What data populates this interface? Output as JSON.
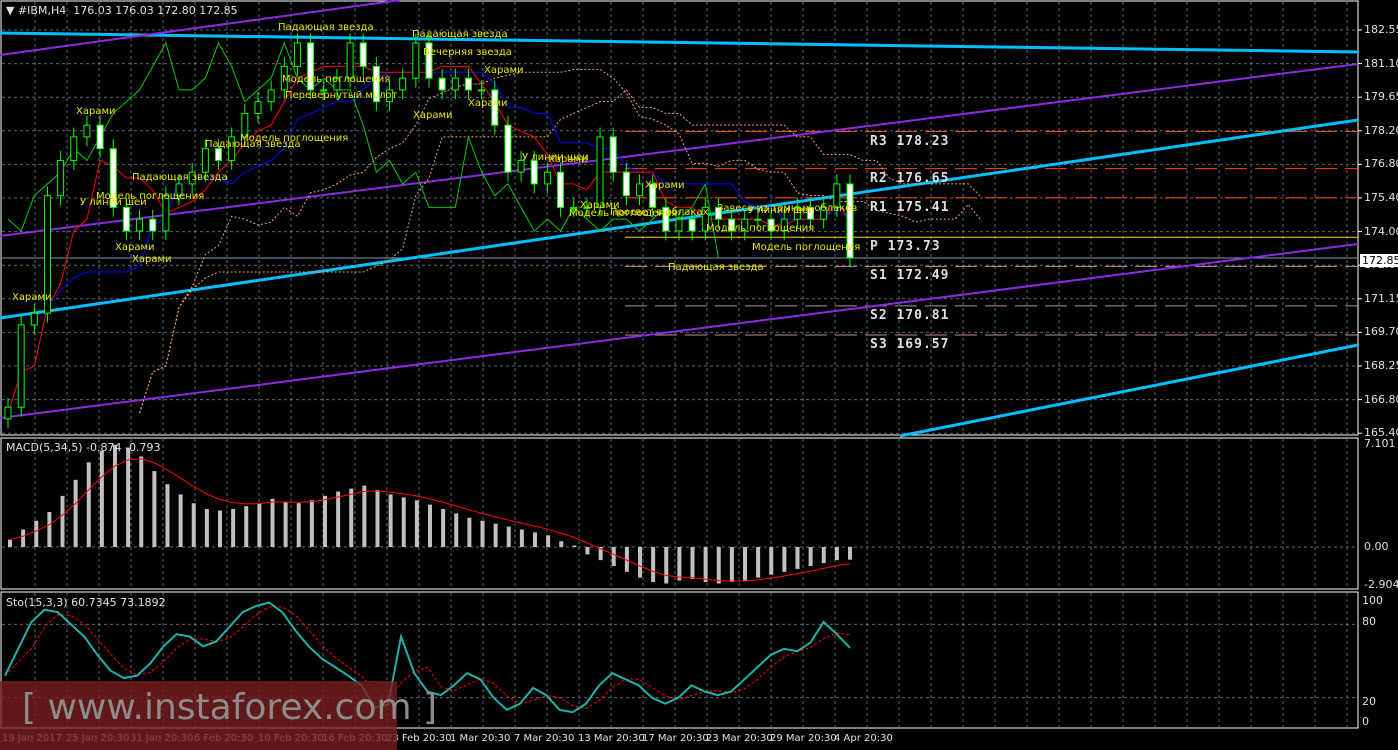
{
  "header": {
    "symbol": "#IBM,H4",
    "ohlc": "176.03 176.03 172.80 172.85"
  },
  "current_price": "172.85",
  "price_axis": [
    "182.55",
    "181.10",
    "179.65",
    "178.20",
    "176.80",
    "175.40",
    "174.00",
    "172.60",
    "171.15",
    "169.70",
    "168.25",
    "166.80",
    "165.40"
  ],
  "pivots": [
    {
      "name": "R3",
      "value": "178.23",
      "label": "R3  178.23"
    },
    {
      "name": "R2",
      "value": "176.65",
      "label": "R2  176.65"
    },
    {
      "name": "R1",
      "value": "175.41",
      "label": "R1  175.41"
    },
    {
      "name": "P",
      "value": "173.73",
      "label": " P  173.73"
    },
    {
      "name": "S1",
      "value": "172.49",
      "label": "S1  172.49"
    },
    {
      "name": "S2",
      "value": "170.81",
      "label": "S2  170.81"
    },
    {
      "name": "S3",
      "value": "169.57",
      "label": "S3  169.57"
    }
  ],
  "patterns": [
    "Падающая звезда",
    "Падающая звезда",
    "Вечерняя звезда",
    "Модель поглощения",
    "Перевернутый молот",
    "Харами",
    "Харами",
    "Харами",
    "Харами",
    "Модель поглощения",
    "Падающая звезда",
    "Падающая звезда",
    "Модель поглощения",
    "У линии шеи",
    "Харами",
    "Харами",
    "Харами",
    "У линии шеи",
    "Харами",
    "Модель поглощения",
    "Просвет в облаках",
    "Харами",
    "Харами",
    "Падающая звезда",
    "Завеса из темных облаков",
    "У линии шеи",
    "Модель поглощения",
    "Модель поглощения"
  ],
  "macd": {
    "legend": "MACD(5,34,5) -0.874 -0.793",
    "axis": [
      "7.101",
      "0.00",
      "-2.904"
    ]
  },
  "stoch": {
    "legend": "Sto(15,3,3) 60.7345 73.1892",
    "axis": [
      "100",
      "80",
      "20",
      "0"
    ]
  },
  "dates": [
    "19 Jan 2017",
    "25 Jan 20:30",
    "31 Jan 20:30",
    "6 Feb 20:30",
    "10 Feb 20:30",
    "16 Feb 20:30",
    "23 Feb 20:30",
    "1 Mar 20:30",
    "7 Mar 20:30",
    "13 Mar 20:30",
    "17 Mar 20:30",
    "23 Mar 20:30",
    "29 Mar 20:30",
    "4 Apr 20:30"
  ],
  "watermark": "[  www.instaforex.com ]",
  "colors": {
    "candle": "#00ff00",
    "tenkan": "#ff0000",
    "kijun": "#0000ff",
    "cloud": "#f4a460",
    "trend_cyan": "#00bfff",
    "trend_purple": "#8a2be2",
    "pivot_r": "#ff4500",
    "pivot_p": "#ffd700",
    "pivot_s": "#c09090",
    "macd_hist": "#c0c0c0",
    "macd_signal": "#ff0000",
    "stoch_main": "#20b2aa",
    "stoch_signal": "#ff0000"
  },
  "chart_data": {
    "type": "candlestick",
    "title": "#IBM,H4",
    "ylim": [
      165.4,
      182.55
    ],
    "closes": [
      166.5,
      170,
      170.5,
      175.5,
      177,
      178,
      178.5,
      177.5,
      175,
      174,
      174.5,
      174,
      175.5,
      176,
      176.5,
      177.5,
      177,
      178,
      179,
      179.5,
      180,
      181,
      182,
      180,
      180,
      180.5,
      182,
      181,
      179.5,
      180,
      180.5,
      182,
      180.5,
      180,
      180.5,
      180,
      180,
      178.5,
      176.5,
      177,
      176,
      176.5,
      175,
      175,
      175,
      178,
      176.5,
      175.5,
      176,
      175,
      174,
      174.5,
      174,
      175,
      174.5,
      174,
      174.5,
      174.5,
      174,
      174.5,
      175,
      174.5,
      175,
      176,
      172.85
    ],
    "macd_hist": [
      0.5,
      1.2,
      1.8,
      2.4,
      3.5,
      4.6,
      5.8,
      6.6,
      7.0,
      6.8,
      6.2,
      5.2,
      4.3,
      3.6,
      3.0,
      2.6,
      2.5,
      2.6,
      2.8,
      3.0,
      3.3,
      3.1,
      3.0,
      3.2,
      3.5,
      3.8,
      4.0,
      4.2,
      3.9,
      3.6,
      3.4,
      3.2,
      2.9,
      2.6,
      2.3,
      2.0,
      1.8,
      1.6,
      1.4,
      1.2,
      1.0,
      0.8,
      0.4,
      0.1,
      -0.5,
      -0.9,
      -1.3,
      -1.7,
      -2.1,
      -2.4,
      -2.5,
      -2.3,
      -2.2,
      -2.4,
      -2.5,
      -2.4,
      -2.3,
      -2.1,
      -1.9,
      -1.7,
      -1.5,
      -1.3,
      -1.1,
      -0.9,
      -0.87
    ],
    "macd_axis": [
      -2.904,
      7.101
    ],
    "stoch_main": [
      38,
      60,
      82,
      92,
      90,
      80,
      70,
      55,
      42,
      36,
      38,
      48,
      62,
      72,
      70,
      62,
      66,
      78,
      90,
      95,
      98,
      90,
      75,
      62,
      52,
      45,
      38,
      30,
      12,
      14,
      70,
      40,
      25,
      22,
      30,
      40,
      35,
      20,
      10,
      15,
      28,
      22,
      10,
      8,
      15,
      30,
      40,
      35,
      30,
      20,
      15,
      20,
      30,
      25,
      22,
      25,
      35,
      45,
      55,
      60,
      58,
      65,
      82,
      72,
      60.7
    ]
  }
}
